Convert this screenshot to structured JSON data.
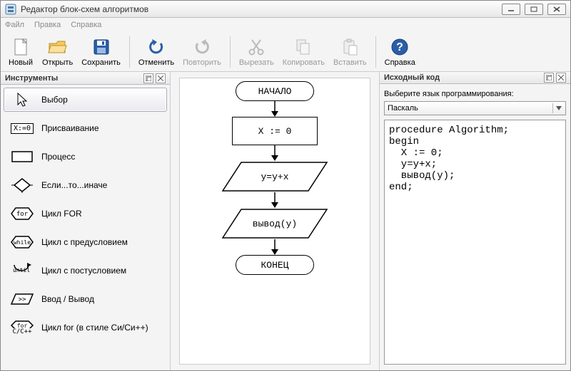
{
  "window": {
    "title": "Редактор блок-схем алгоритмов"
  },
  "menu": {
    "file": "Файл",
    "edit": "Правка",
    "help": "Справка"
  },
  "toolbar": {
    "new": "Новый",
    "open": "Открыть",
    "save": "Сохранить",
    "undo": "Отменить",
    "redo": "Повторить",
    "cut": "Вырезать",
    "copy": "Копировать",
    "paste": "Вставить",
    "help": "Справка"
  },
  "panels": {
    "tools_title": "Инструменты",
    "code_title": "Исходный код"
  },
  "tools": {
    "select": "Выбор",
    "assign": "Присваивание",
    "assign_icon_text": "X:=0",
    "process": "Процесс",
    "ifelse": "Если...то...иначе",
    "for": "Цикл FOR",
    "for_icon_text": "for",
    "while": "Цикл с предусловием",
    "while_icon_text": "while",
    "until": "Цикл с постусловием",
    "until_icon_text": "until",
    "io": "Ввод / Вывод",
    "io_icon_text": ">>",
    "cfor": "Цикл for (в стиле Си/Си++)",
    "cfor_icon_text": "for",
    "cfor_icon_sub": "C/C++"
  },
  "flowchart": {
    "start": "НАЧАЛО",
    "n1": "X := 0",
    "n2": "y=y+x",
    "n3": "вывод(y)",
    "end": "КОНЕЦ"
  },
  "codepanel": {
    "lang_label": "Выберите язык программирования:",
    "lang_value": "Паскаль",
    "code": "procedure Algorithm;\nbegin\n  X := 0;\n  y=y+x;\n  вывод(y);\nend;"
  }
}
